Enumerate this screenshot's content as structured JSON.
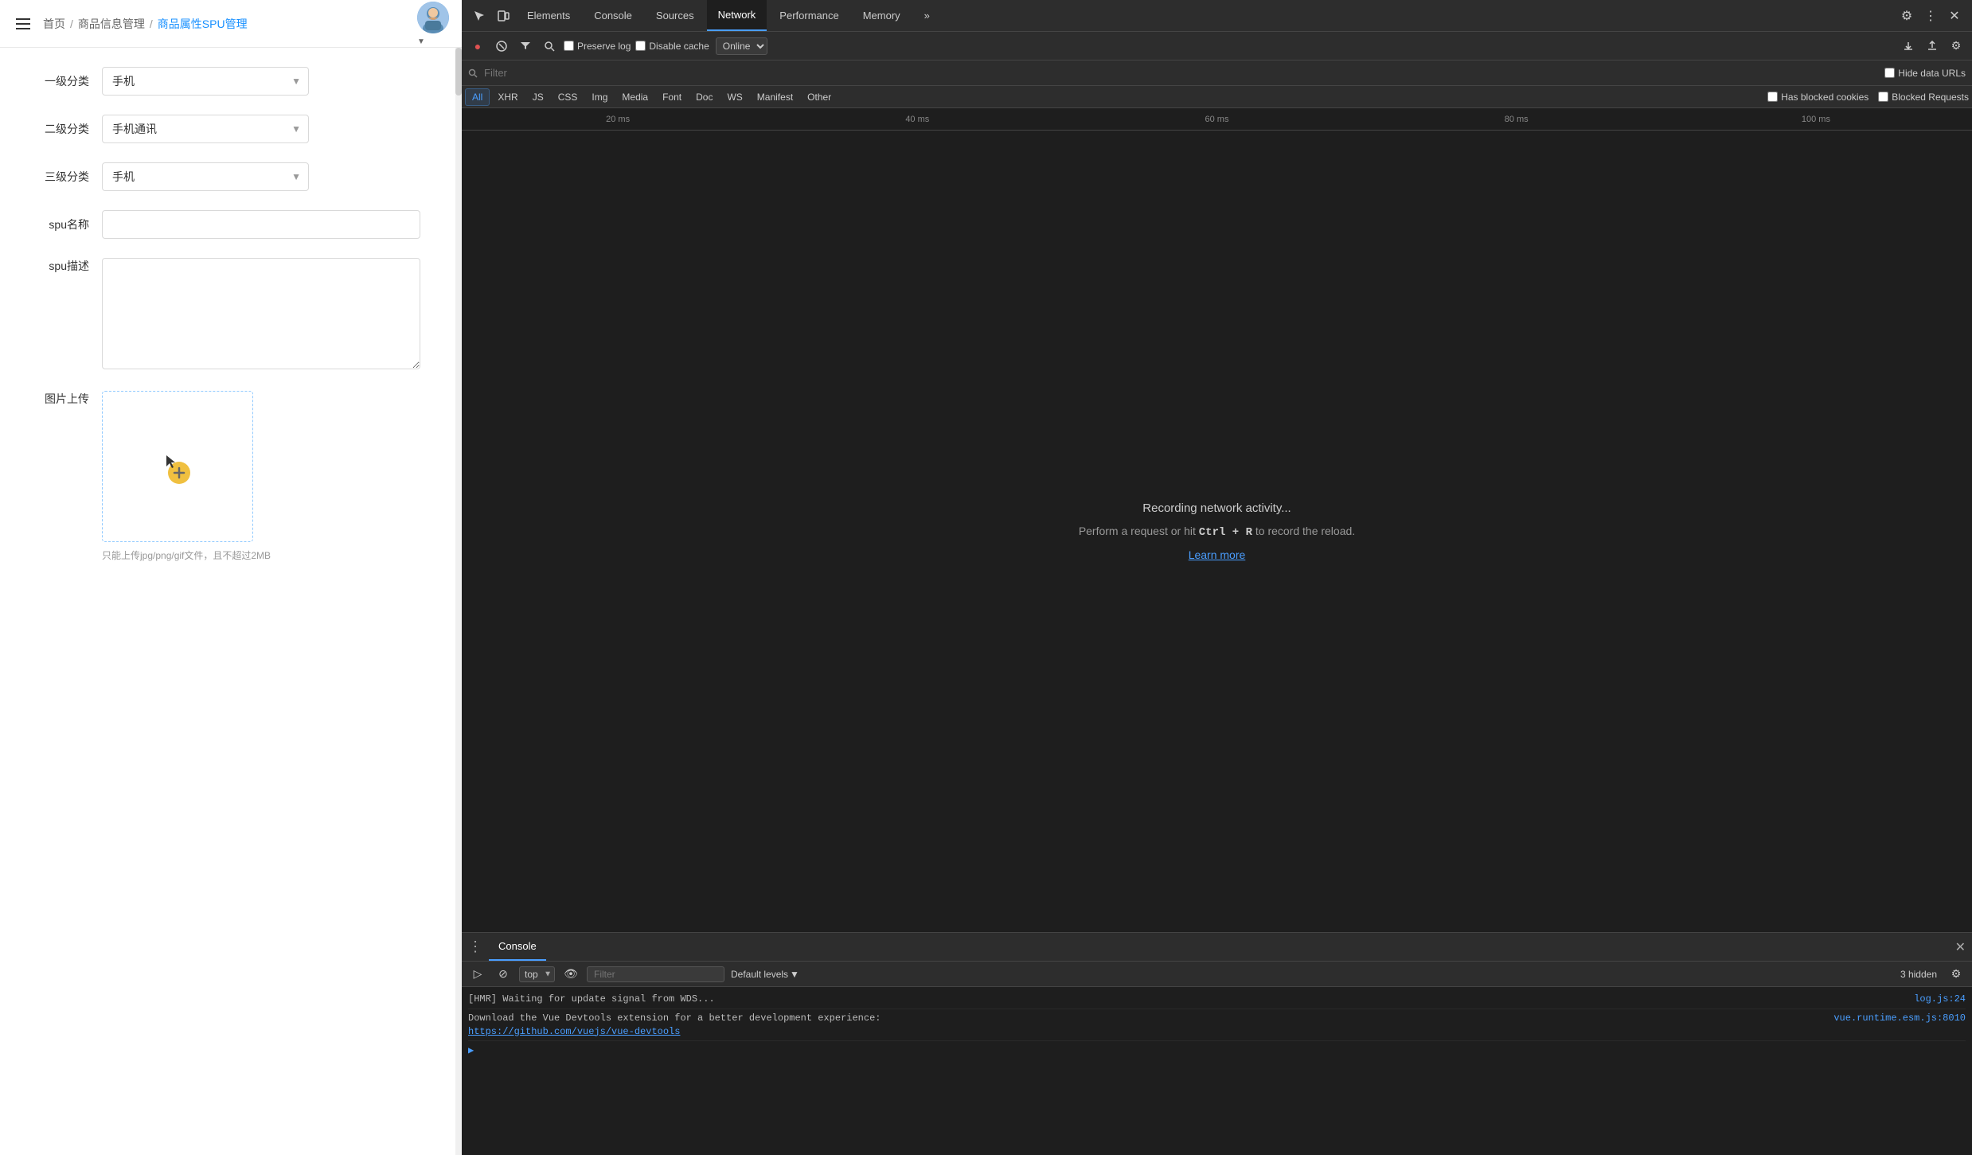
{
  "app": {
    "header": {
      "breadcrumbs": [
        {
          "label": "首页",
          "active": false
        },
        {
          "label": "商品信息管理",
          "active": false
        },
        {
          "label": "商品属性SPU管理",
          "active": true
        }
      ]
    },
    "form": {
      "fields": [
        {
          "label": "一级分类",
          "type": "select",
          "value": "手机",
          "placeholder": ""
        },
        {
          "label": "二级分类",
          "type": "select",
          "value": "手机通讯",
          "placeholder": ""
        },
        {
          "label": "三级分类",
          "type": "select",
          "value": "手机",
          "placeholder": ""
        },
        {
          "label": "spu名称",
          "type": "input",
          "value": "",
          "placeholder": ""
        },
        {
          "label": "spu描述",
          "type": "textarea",
          "value": "",
          "placeholder": ""
        },
        {
          "label": "图片上传",
          "type": "upload"
        }
      ],
      "upload_hint": "只能上传jpg/png/gif文件，且不超过2MB"
    }
  },
  "devtools": {
    "tabs": [
      {
        "label": "Elements",
        "active": false
      },
      {
        "label": "Console",
        "active": false
      },
      {
        "label": "Sources",
        "active": false
      },
      {
        "label": "Network",
        "active": true
      },
      {
        "label": "Performance",
        "active": false
      },
      {
        "label": "Memory",
        "active": false
      },
      {
        "label": "»",
        "active": false
      }
    ],
    "network": {
      "toolbar": {
        "preserve_log_label": "Preserve log",
        "disable_cache_label": "Disable cache",
        "online_label": "Online"
      },
      "filter_placeholder": "Filter",
      "hide_data_urls_label": "Hide data URLs",
      "type_filters": [
        "All",
        "XHR",
        "JS",
        "CSS",
        "Img",
        "Media",
        "Font",
        "Doc",
        "WS",
        "Manifest",
        "Other"
      ],
      "active_type_filter": "All",
      "has_blocked_cookies_label": "Has blocked cookies",
      "blocked_requests_label": "Blocked Requests",
      "timeline_labels": [
        "20 ms",
        "40 ms",
        "60 ms",
        "80 ms",
        "100 ms"
      ],
      "recording_text": "Recording network activity...",
      "perform_text_before": "Perform a request or hit ",
      "perform_shortcut": "Ctrl + R",
      "perform_text_after": " to record the reload.",
      "learn_more_label": "Learn more"
    },
    "console": {
      "tab_label": "Console",
      "toolbar": {
        "target": "top",
        "filter_placeholder": "Filter",
        "levels_label": "Default levels",
        "hidden_count": "3 hidden"
      },
      "lines": [
        {
          "text": "[HMR] Waiting for update signal from WDS...",
          "source": "log.js:24"
        },
        {
          "text": "Download the Vue Devtools extension for a better development experience:\nhttps://github.com/vuejs/vue-devtools",
          "source": "vue.runtime.esm.js:8010",
          "link": "https://github.com/vuejs/vue-devtools"
        }
      ]
    }
  }
}
